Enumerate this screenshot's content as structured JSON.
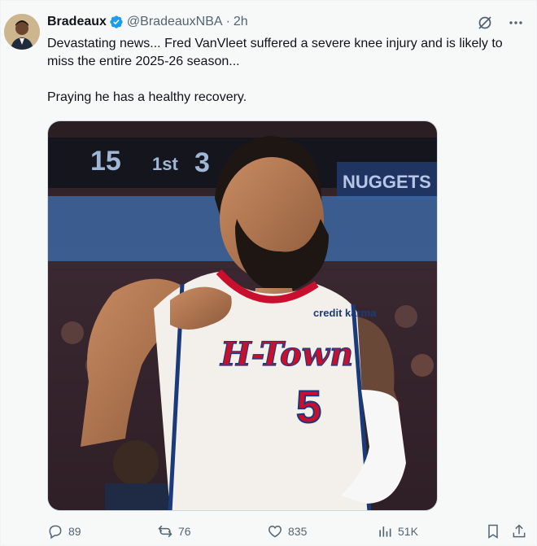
{
  "author": {
    "name": "Bradeaux",
    "handle": "@BradeauxNBA",
    "time": "2h"
  },
  "post": {
    "line1": "Devastating news... Fred VanVleet suffered a severe knee injury and is likely to miss the entire 2025-26 season...",
    "line2": "Praying he has a healthy recovery."
  },
  "media": {
    "jersey_city": "H-Town",
    "jersey_number": "5",
    "sponsor": "credit karma",
    "scoreboard_a": "15",
    "scoreboard_b": "1st",
    "scoreboard_c": "3",
    "scoreboard_team": "NUGGETS"
  },
  "metrics": {
    "replies": "89",
    "reposts": "76",
    "likes": "835",
    "views": "51K"
  },
  "colors": {
    "verified": "#1d9bf0",
    "muted": "#536471",
    "jersey_red": "#c8102e"
  }
}
